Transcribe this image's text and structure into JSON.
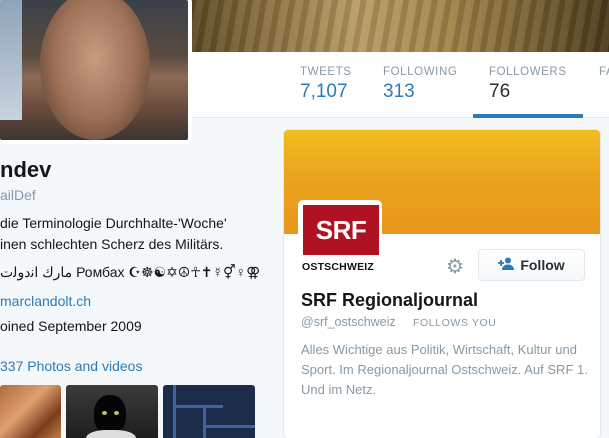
{
  "profile": {
    "name": "ndev",
    "handle": "ailDef",
    "bio_line1": "die Terminologie Durchhalte-'Woche'",
    "bio_line2": "inen schlechten Scherz des Militärs.",
    "symbols": "ﻣﺎرك اﻧدوﻟت Ромбах ☪☸☯✡☮☥✝☿⚥♀⚢",
    "website": "marclandolt.ch",
    "joined": "oined September 2009",
    "photos_link": "337 Photos and videos"
  },
  "nav": {
    "tweets": {
      "label": "TWEETS",
      "value": "7,107"
    },
    "following": {
      "label": "FOLLOWING",
      "value": "313"
    },
    "followers": {
      "label": "FOLLOWERS",
      "value": "76"
    },
    "favorites": {
      "label": "FA"
    }
  },
  "card": {
    "logo_text": "SRF",
    "logo_sub": "OSTSCHWEIZ",
    "name": "SRF Regionaljournal",
    "handle": "@srf_ostschweiz",
    "follows_you": "FOLLOWS YOU",
    "follow_label": "Follow",
    "bio": "Alles Wichtige aus Politik, Wirtschaft, Kultur und Sport. Im Regionaljournal Ostschweiz. Auf SRF 1. Und im Netz.",
    "icons": {
      "settings": "gear-icon",
      "follow": "person-add-icon"
    }
  },
  "colors": {
    "link": "#2b7bb9",
    "srf_red": "#b01224",
    "banner_yellow": "#f2bd1f"
  }
}
